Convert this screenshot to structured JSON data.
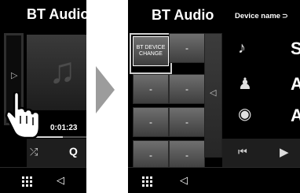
{
  "left_screen": {
    "title": "BT Audio",
    "time": "0:01:23",
    "progress": 0.6
  },
  "right_screen": {
    "title": "BT Audio",
    "device_name_label": "Device name",
    "device_change_label": "BT DEVICE CHANGE",
    "tiles": [
      "-",
      "-",
      "-",
      "-",
      "-",
      "-",
      "-",
      "-",
      "-"
    ],
    "info_rows": [
      {
        "icon": "music-note-icon",
        "text": "S"
      },
      {
        "icon": "artist-icon",
        "text": "A"
      },
      {
        "icon": "album-icon",
        "text": "Al"
      }
    ]
  },
  "icons": {
    "hand": "tap-hand-icon",
    "home": "home-grid-icon",
    "back": "back-icon"
  },
  "colors": {
    "screen_bg": "#000000",
    "tile_top": "#6f6f6f",
    "tile_bottom": "#3e3e3e",
    "arrow": "#9c9c9c"
  }
}
